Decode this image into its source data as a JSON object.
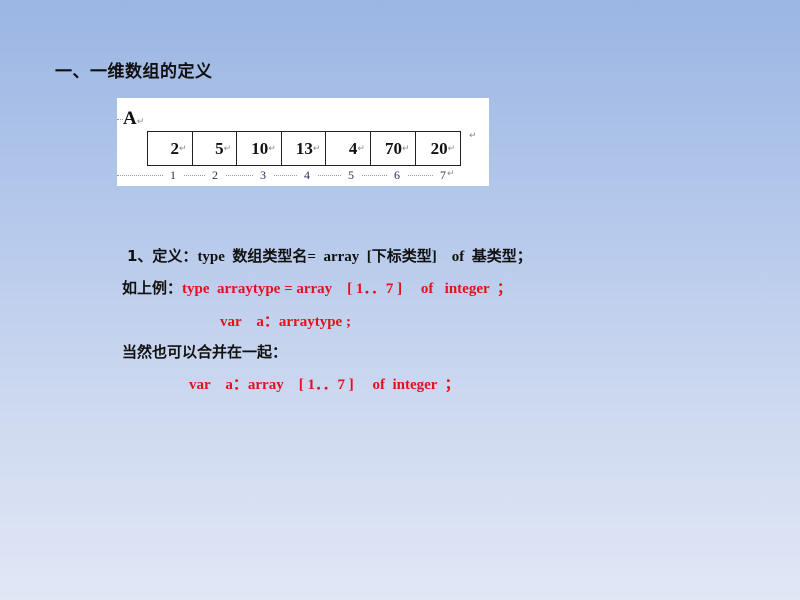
{
  "slide": {
    "title": "一、一维数组的定义",
    "figure": {
      "array_label": "A",
      "return_mark": "↵",
      "cells": [
        "2",
        "5",
        "10",
        "13",
        "4",
        "70",
        "20"
      ],
      "indices": [
        "1",
        "2",
        "3",
        "4",
        "5",
        "6",
        "7"
      ]
    },
    "definition": {
      "prefix": "1、定义：",
      "text": "type  数组类型名=  array  [下标类型]    of  基类型；"
    },
    "example": {
      "prefix": "如上例：",
      "line1": "type  arraytype = array    [ 1．．7 ]     of   integer  ；",
      "line2": "var    a：arraytype ;"
    },
    "combined": {
      "prefix": "当然也可以合并在一起：",
      "line": "var    a：array    [ 1．．7 ]     of  integer  ；"
    },
    "colors": {
      "code_red": "#e3101e",
      "text_black": "#111111",
      "bg_top": "#9bb6e3",
      "bg_bottom": "#e1e7f5"
    }
  }
}
